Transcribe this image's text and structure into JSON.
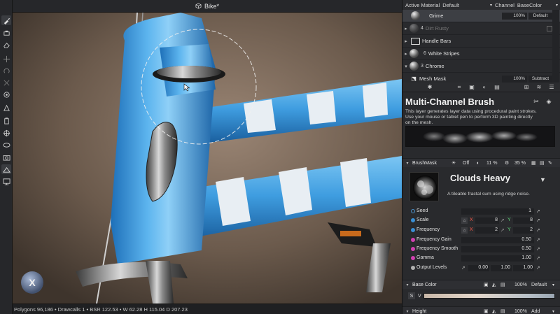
{
  "viewport": {
    "title": "Bike*",
    "status": "Polygons 96,186 • Drawcalls 1 • BSR 122.53 • W 62.28 H 115.04 D 207.23",
    "gizmo_label": "X"
  },
  "toolbar": {
    "tools": [
      "brush-icon",
      "eraser-icon",
      "fill-icon",
      "smudge-icon",
      "clone-icon",
      "transform-icon",
      "projection-icon",
      "polygon-fill-icon",
      "bucket-icon",
      "picker-icon",
      "camera-icon",
      "env-icon",
      "display-icon"
    ]
  },
  "panel": {
    "header": {
      "active_material_label": "Active Material",
      "active_material_value": "Default",
      "channel_label": "Channel",
      "channel_value": "BaseColor"
    },
    "layers": [
      {
        "name": "Grime",
        "count": "",
        "opacity": "100%",
        "blend": "Default",
        "selected": true,
        "dim": false
      },
      {
        "name": "Dirt Rusty",
        "count": "4",
        "opacity": "",
        "blend": "",
        "selected": false,
        "dim": true
      },
      {
        "name": "Handle Bars",
        "count": "",
        "opacity": "",
        "blend": "",
        "selected": false,
        "dim": false
      },
      {
        "name": "White Stripes",
        "count": "6",
        "opacity": "",
        "blend": "",
        "selected": false,
        "dim": false
      },
      {
        "name": "Chrome",
        "count": "3",
        "opacity": "",
        "blend": "",
        "selected": false,
        "dim": false
      },
      {
        "name": "Mesh Mask",
        "count": "",
        "opacity": "100%",
        "blend": "Subtract",
        "selected": false,
        "dim": false
      }
    ],
    "brush": {
      "title": "Multi-Channel Brush",
      "description": "This layer generates layer data using procedural paint strokes. Use your mouse or tablet pen to perform 3D painting directly on the mesh."
    },
    "brush_mask": {
      "label": "BrushMask",
      "toggle": "Off",
      "value1": "11 %",
      "value2": "35 %"
    },
    "noise": {
      "name": "Clouds Heavy",
      "description": "A tileable fractal sum using ridge noise."
    },
    "params": {
      "seed": {
        "label": "Seed",
        "value": "1"
      },
      "scale": {
        "label": "Scale",
        "x": "8",
        "y": "8"
      },
      "frequency": {
        "label": "Frequency",
        "x": "2",
        "y": "2"
      },
      "frequency_gain": {
        "label": "Frequency Gain",
        "value": "0.50"
      },
      "frequency_smooth": {
        "label": "Frequency Smooth",
        "value": "0.50"
      },
      "gamma": {
        "label": "Gamma",
        "value": "1.00"
      },
      "output_levels": {
        "label": "Output Levels",
        "min": "0.00",
        "mid": "1.00",
        "max": "1.00"
      }
    },
    "base_color": {
      "label": "Base Color",
      "opacity": "100%",
      "blend": "Default",
      "s": "S",
      "v": "V"
    },
    "height": {
      "label": "Height",
      "opacity": "100%",
      "blend": "Add"
    },
    "axis": {
      "x": "X",
      "y": "Y"
    }
  }
}
